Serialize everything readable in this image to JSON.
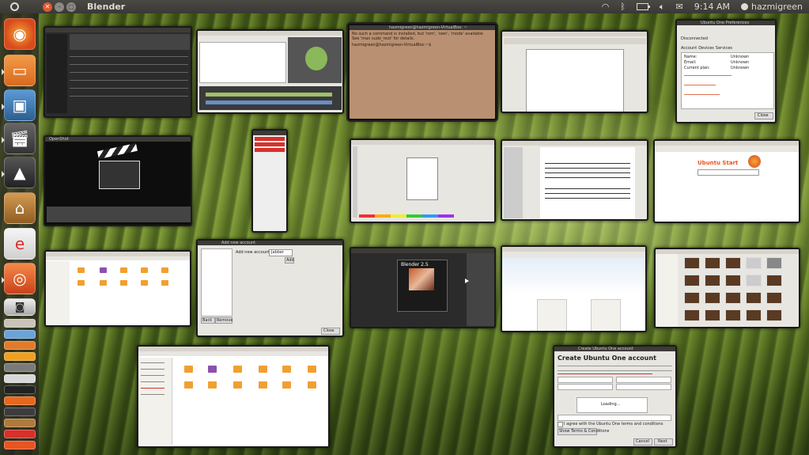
{
  "panel": {
    "app_title": "Blender",
    "time": "9:14 AM",
    "username": "hazmigreen"
  },
  "launcher": {
    "items": [
      {
        "name": "Firefox",
        "icon": "firefox-icon",
        "color": "#e8661d"
      },
      {
        "name": "Files",
        "icon": "folder-icon",
        "color": "#e07b2c"
      },
      {
        "name": "Shotwell",
        "icon": "photos-icon",
        "color": "#3a7ab8"
      },
      {
        "name": "OpenShot",
        "icon": "clapperboard-icon",
        "color": "#444444"
      },
      {
        "name": "Inkscape",
        "icon": "inkscape-icon",
        "color": "#333333"
      },
      {
        "name": "Software Center",
        "icon": "software-center-icon",
        "color": "#b07a3c"
      },
      {
        "name": "Ebook",
        "icon": "ebook-icon",
        "color": "#d8302a"
      },
      {
        "name": "Ubuntu One",
        "icon": "ubuntu-icon",
        "color": "#e95420"
      }
    ]
  },
  "windows": {
    "terminal": {
      "title": "hazmigreen@hazmigreen-VirtualBox: ~",
      "line1": "No such a command is installed, but 'rom', 'own', 'mode' available",
      "line2": "See 'man sudo_root' for details.",
      "prompt": "hazmigreen@hazmigreen-VirtualBox:~$"
    },
    "ubuntu_one_prefs": {
      "title": "Ubuntu One Preferences",
      "status": "Disconnected",
      "tabs": [
        "Account",
        "Devices",
        "Services"
      ],
      "rows": [
        {
          "label": "Name:",
          "value": "Unknown"
        },
        {
          "label": "Email:",
          "value": "Unknown"
        },
        {
          "label": "Current plan:",
          "value": "Unknown"
        }
      ],
      "close_label": "Close"
    },
    "openshot_splash": {
      "title": "OpenShot"
    },
    "empathy": {
      "title": "Add new account",
      "add_label": "Add new account for:",
      "protocol": "Jabber",
      "add_button": "Add",
      "back_button": "Back",
      "remove_button": "Remove",
      "close_button": "Close"
    },
    "firefox": {
      "title": "Ubuntu Start"
    },
    "blender": {
      "splash_title": "Blender 2.5"
    },
    "ubuntu_one_signup": {
      "title": "Create Ubuntu One account",
      "heading": "Create Ubuntu One account",
      "loading": "Loading...",
      "agree": "I agree with the Ubuntu One terms and conditions",
      "terms_button": "Show Terms & Conditions",
      "cancel": "Cancel",
      "next": "Next"
    }
  }
}
